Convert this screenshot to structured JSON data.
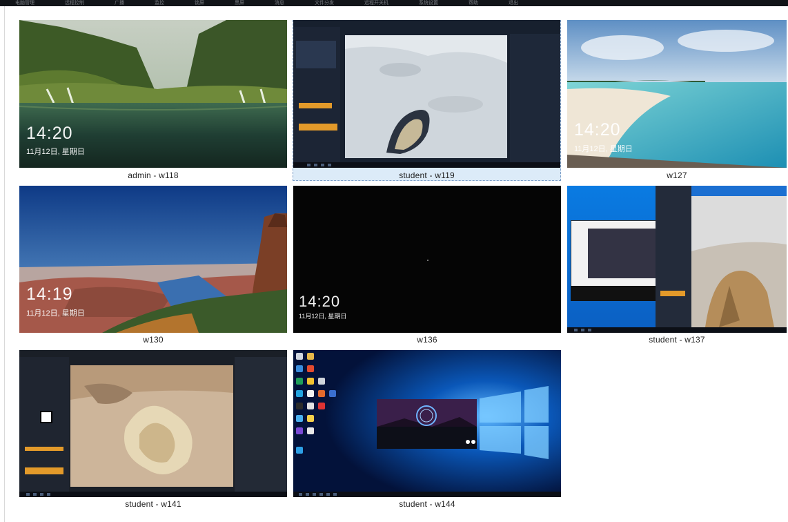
{
  "topbar": {
    "menu_items": [
      "电脑管理",
      "远程控制",
      "广播",
      "监控",
      "锁屏",
      "黑屏",
      "消息",
      "文件分发",
      "远程开关机",
      "系统设置",
      "帮助",
      "退出"
    ]
  },
  "tiles": [
    {
      "label": "admin - w118",
      "clock": "14:20",
      "date": "11月12日, 星期日",
      "selected": false
    },
    {
      "label": "student - w119",
      "selected": true
    },
    {
      "label": "w127",
      "clock": "14:20",
      "date": "11月12日, 星期日",
      "selected": false
    },
    {
      "label": "w130",
      "clock": "14:19",
      "date": "11月12日, 星期日",
      "selected": false
    },
    {
      "label": "w136",
      "clock": "14:20",
      "date": "11月12日, 星期日",
      "selected": false
    },
    {
      "label": "student - w137",
      "selected": false
    },
    {
      "label": "student - w141",
      "selected": false
    },
    {
      "label": "student - w144",
      "selected": false
    }
  ],
  "colors": {
    "selection": "#dcebf8",
    "accent_orange": "#e39a2a",
    "editor_dark": "#1b2230"
  }
}
